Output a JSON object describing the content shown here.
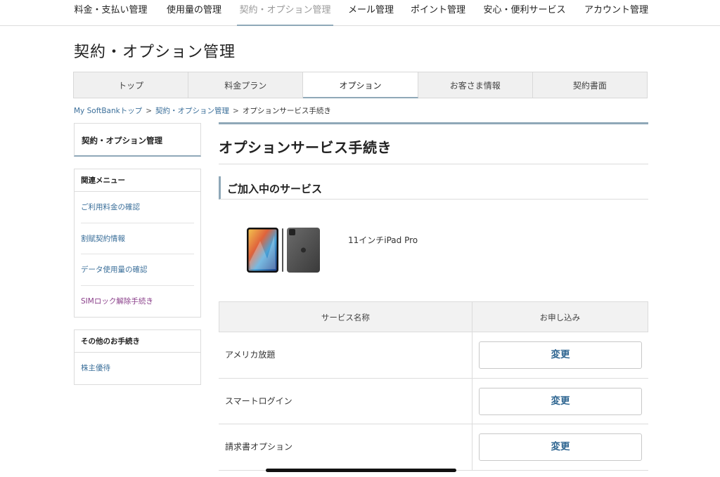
{
  "topnav": {
    "items": [
      {
        "label": "料金・支払い管理"
      },
      {
        "label": "使用量の管理"
      },
      {
        "label": "契約・オプション管理"
      },
      {
        "label": "メール管理"
      },
      {
        "label": "ポイント管理"
      },
      {
        "label": "安心・便利サービス"
      },
      {
        "label": "アカウント管理"
      }
    ],
    "active_index": 2
  },
  "page_title": "契約・オプション管理",
  "tabs": [
    {
      "label": "トップ"
    },
    {
      "label": "料金プラン"
    },
    {
      "label": "オプション"
    },
    {
      "label": "お客さま情報"
    },
    {
      "label": "契約書面"
    }
  ],
  "breadcrumb": {
    "items": [
      "My SoftBankトップ",
      "契約・オプション管理",
      "オプションサービス手続き"
    ],
    "separator": ">"
  },
  "sidebar": {
    "title": "契約・オプション管理",
    "related": {
      "heading": "関連メニュー",
      "links": [
        {
          "label": "ご利用料金の確認"
        },
        {
          "label": "割賦契約情報"
        },
        {
          "label": "データ使用量の確認"
        },
        {
          "label": "SIMロック解除手続き"
        }
      ]
    },
    "other": {
      "heading": "その他のお手続き",
      "links": [
        {
          "label": "株主優待"
        }
      ]
    }
  },
  "main": {
    "heading": "オプションサービス手続き",
    "subheading": "ご加入中のサービス",
    "device_name": "11インチiPad Pro",
    "table": {
      "headers": [
        "サービス名称",
        "お申し込み"
      ],
      "rows": [
        {
          "name": "アメリカ放題",
          "action": "変更"
        },
        {
          "name": "スマートログイン",
          "action": "変更"
        },
        {
          "name": "請求書オプション",
          "action": "変更"
        }
      ]
    }
  },
  "colors": {
    "accent_line": "#8fa8b8",
    "link": "#3b6f9a",
    "visited_link": "#8a3f8a",
    "button_text": "#2f6691"
  }
}
